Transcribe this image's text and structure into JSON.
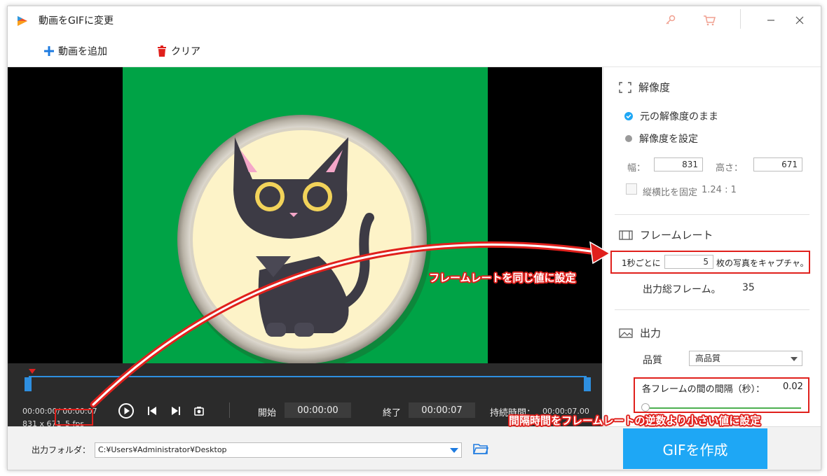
{
  "app": {
    "title": "動画をGIFに変更"
  },
  "toolbar": {
    "add_label": "動画を追加",
    "clear_label": "クリア"
  },
  "player": {
    "current_time": "00:00:00",
    "total_time": "/ 00:00:07",
    "resolution": "831 x 671",
    "fps": "5 fps",
    "start_label": "開始",
    "start_value": "00:00:00",
    "end_label": "終了",
    "end_value": "00:00:07",
    "duration_label": "持続時間：",
    "duration_value": "00:00:07.00"
  },
  "resolution": {
    "title": "解像度",
    "option_keep": "元の解像度のまま",
    "option_set": "解像度を設定",
    "width_label": "幅：",
    "width_value": "831",
    "height_label": "高さ：",
    "height_value": "671",
    "lock_label": "縦横比を固定",
    "ratio": "1.24 : 1"
  },
  "framerate": {
    "title": "フレームレート",
    "per_sec_prefix": "1秒ごとに",
    "per_sec_value": "5",
    "per_sec_suffix": "枚の写真をキャプチャ。",
    "total_label": "出力総フレーム。",
    "total_value": "35"
  },
  "output": {
    "title": "出力",
    "quality_label": "品質",
    "quality_value": "高品質",
    "interval_label": "各フレームの間の間隔（秒）：",
    "interval_value": "0.02",
    "interval_slider_fraction": 0.0
  },
  "bottom": {
    "folder_label": "出力フォルダ：",
    "folder_path": "C:¥Users¥Administrator¥Desktop",
    "create_label": "GIFを作成"
  },
  "annotations": {
    "framerate_note": "フレームレートを同じ値に設定",
    "interval_note": "間隔時間をフレームレートの逆数より小さい値に設定"
  },
  "colors": {
    "accent": "#1ea7f5",
    "annotation_red": "#e0201c",
    "video_bg": "#00a346"
  }
}
